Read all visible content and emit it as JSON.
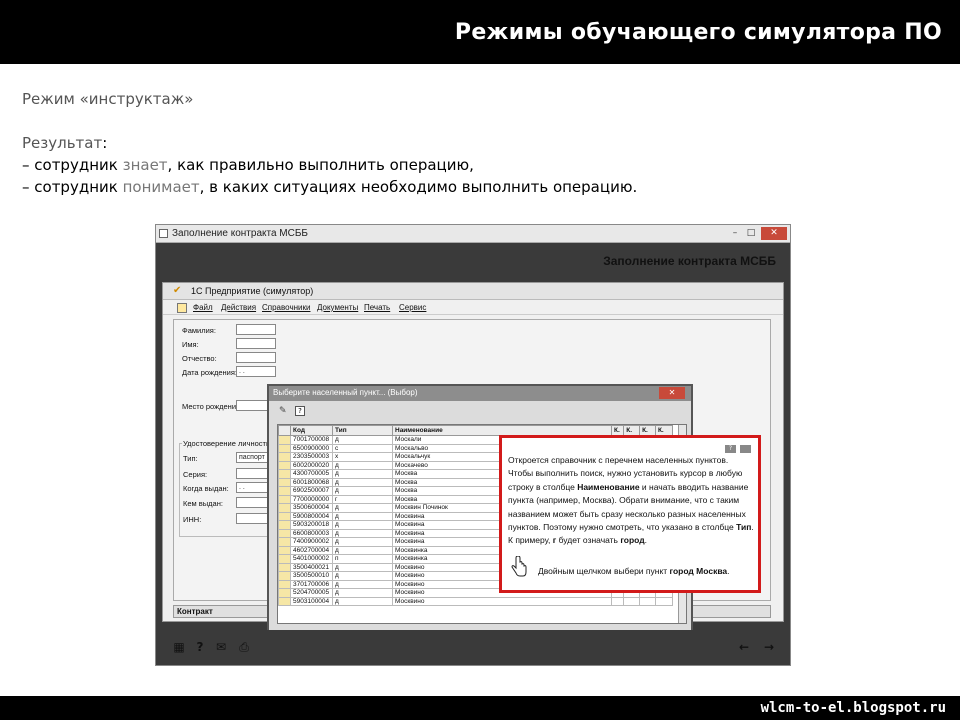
{
  "slide": {
    "title": "Режимы обучающего симулятора ПО",
    "mode": "Режим «инструктаж»",
    "result_head": "Результат",
    "result_colon": ":",
    "line1_a": "– сотрудник ",
    "line1_b": "знает",
    "line1_c": ", как правильно выполнить операцию,",
    "line2_a": "– сотрудник ",
    "line2_b": "понимает",
    "line2_c": ", в каких ситуациях необходимо выполнить операцию.",
    "footer_url": "wlcm-to-el.blogspot.ru"
  },
  "sim": {
    "window_title": "Заполнение контракта МСББ",
    "header": "Заполнение контракта МСББ",
    "win_min": "–",
    "win_max": "□",
    "win_close": "✕",
    "bottom_icons": [
      "grid-icon",
      "help-icon",
      "mail-icon",
      "print-icon",
      "back-arrow-icon",
      "forward-arrow-icon"
    ]
  },
  "app": {
    "title": "1С Предприятие (симулятор)",
    "menu": [
      "Файл",
      "Действия",
      "Справочники",
      "Документы",
      "Печать",
      "Сервис"
    ],
    "tab": "Контракт"
  },
  "form": {
    "surname": "Фамилия:",
    "name": "Имя:",
    "patronymic": "Отчество:",
    "birthdate": "Дата рождения:",
    "birthdate_value": ". .",
    "birthplace": "Место рождения:",
    "id_group": "Удостоверение личности",
    "type": "Тип:",
    "type_value": "паспорт",
    "series": "Серия:",
    "issued_when": "Когда выдан:",
    "issued_when_value": ". .",
    "issued_by": "Кем выдан:",
    "inn": "ИНН:"
  },
  "dialog": {
    "title": "Выберите населенный пункт... (Выбор)",
    "close": "✕",
    "columns": [
      "Код",
      "Тип",
      "Наименование",
      "К.",
      "К.",
      "К.",
      "К."
    ],
    "rows": [
      [
        "7001700008",
        "д",
        "Москали",
        "70",
        "017",
        "000",
        "087"
      ],
      [
        "6500900000",
        "с",
        "Москальво",
        "65",
        "009",
        "000",
        "006"
      ],
      [
        "2303500003",
        "х",
        "Москальчук",
        "23",
        "035",
        "000",
        "031"
      ],
      [
        "6002000020",
        "д",
        "Москачево",
        "60",
        "020",
        "000",
        "205"
      ],
      [
        "4300700005",
        "д",
        "Москва",
        "43",
        "007",
        "000",
        "054"
      ],
      [
        "6001800068",
        "д",
        "Москва",
        "60",
        "018",
        "000",
        "683"
      ],
      [
        "6902500007",
        "д",
        "Москва",
        "",
        "",
        "",
        ""
      ],
      [
        "7700000000",
        "г",
        "Москва",
        "",
        "",
        "",
        ""
      ],
      [
        "3500600004",
        "д",
        "Москвин Починок",
        "",
        "",
        "",
        ""
      ],
      [
        "5900800004",
        "д",
        "Москвина",
        "",
        "",
        "",
        ""
      ],
      [
        "5903200018",
        "д",
        "Москвина",
        "",
        "",
        "",
        ""
      ],
      [
        "6600800003",
        "д",
        "Москвина",
        "",
        "",
        "",
        ""
      ],
      [
        "7400900002",
        "д",
        "Москвина",
        "",
        "",
        "",
        ""
      ],
      [
        "4602700004",
        "д",
        "Москвинка",
        "",
        "",
        "",
        ""
      ],
      [
        "5401000002",
        "п",
        "Москвинка",
        "",
        "",
        "",
        ""
      ],
      [
        "3500400021",
        "д",
        "Москвино",
        "",
        "",
        "",
        ""
      ],
      [
        "3500500010",
        "д",
        "Москвино",
        "",
        "",
        "",
        ""
      ],
      [
        "3701700006",
        "д",
        "Москвино",
        "",
        "",
        "",
        ""
      ],
      [
        "5204700005",
        "д",
        "Москвино",
        "",
        "",
        "",
        ""
      ],
      [
        "5903100004",
        "д",
        "Москвино",
        "",
        "",
        "",
        ""
      ]
    ]
  },
  "tooltip": {
    "help": "?",
    "p1": "Откроется справочник с перечнем населенных пунктов. Чтобы выполнить поиск, нужно установить курсор в любую строку в столбце ",
    "p1_bold": "Наименование",
    "p2": " и начать вводить название пункта (например, Москва). Обрати внимание, что с таким названием может быть сразу несколько разных населенных пунктов. Поэтому нужно смотреть, что указано в столбце ",
    "p2_bold": "Тип",
    "p3": ". К примеру, ",
    "p3_bold": "г",
    "p4": " будет означать ",
    "p4_bold": "город",
    "p5": ".",
    "action": "Двойным щелчком выбери пункт ",
    "action_bold": "город Москва",
    "action_end": "."
  }
}
